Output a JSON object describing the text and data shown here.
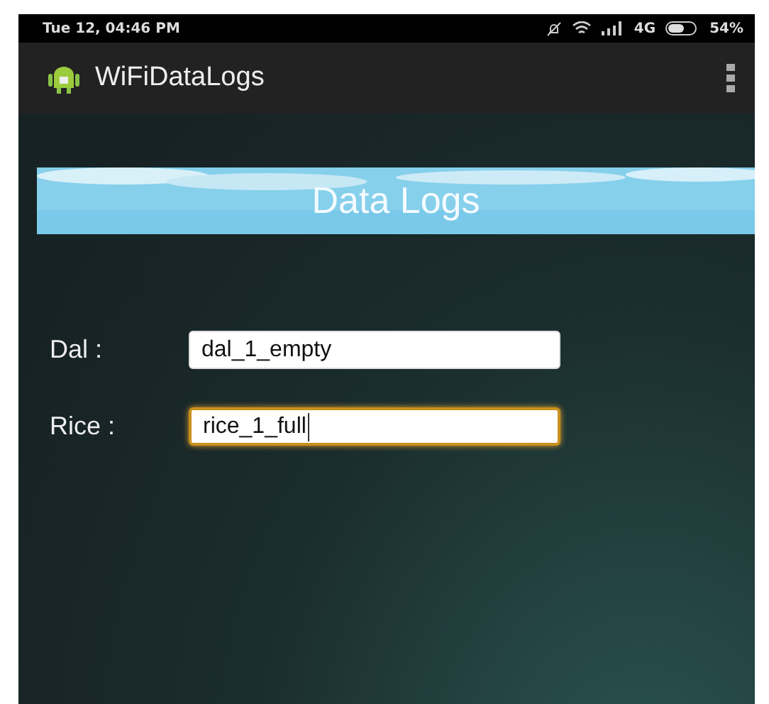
{
  "status_bar": {
    "time": "Tue 12, 04:46 PM",
    "network": "4G",
    "battery": "54%"
  },
  "app_bar": {
    "title": "WiFiDataLogs"
  },
  "banner": {
    "title": "Data Logs"
  },
  "fields": [
    {
      "label": "Dal :",
      "value": "dal_1_empty",
      "focused": false
    },
    {
      "label": "Rice :",
      "value": "rice_1_full",
      "focused": true
    }
  ]
}
